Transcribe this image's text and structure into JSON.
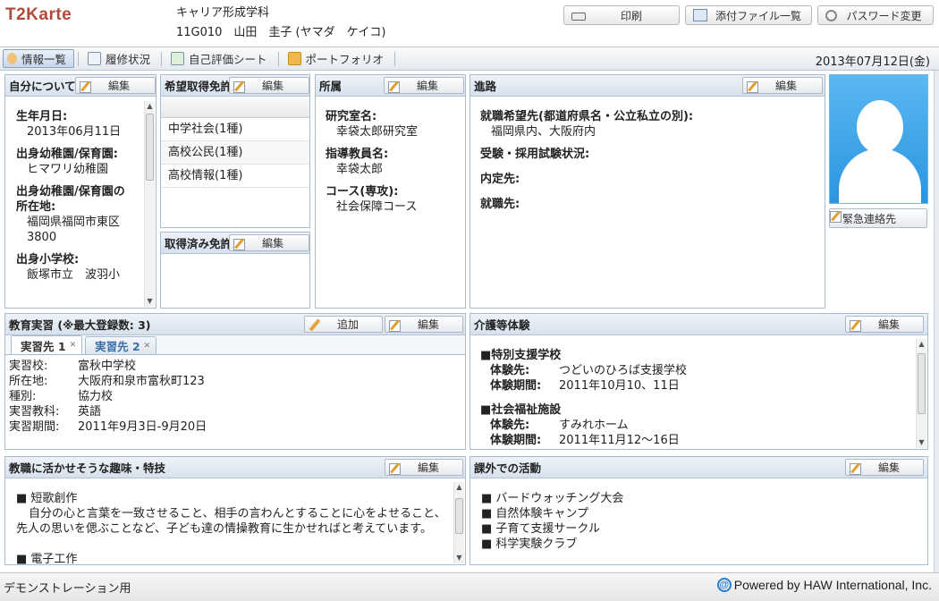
{
  "header": {
    "logo": "T2Karte",
    "department": "キャリア形成学科",
    "student_line": "11G010　山田　圭子 (ヤマダ　ケイコ)",
    "buttons": {
      "print": "印刷",
      "attachments": "添付ファイル一覧",
      "password": "パスワード変更"
    }
  },
  "nav": {
    "tabs": [
      "情報一覧",
      "履修状況",
      "自己評価シート",
      "ポートフォリオ"
    ],
    "date": "2013年07月12日(金)"
  },
  "common": {
    "edit": "編集",
    "add": "追加"
  },
  "about": {
    "title": "自分について",
    "fields": [
      {
        "label": "生年月日:",
        "value": "2013年06月11日"
      },
      {
        "label": "出身幼稚園/保育園:",
        "value": "ヒマワリ幼稚園"
      },
      {
        "label": "出身幼稚園/保育園の所在地:",
        "value": "福岡県福岡市東区3800"
      },
      {
        "label": "出身小学校:",
        "value": "飯塚市立　波羽小"
      }
    ]
  },
  "desired_license": {
    "title": "希望取得免許",
    "items": [
      "中学社会(1種)",
      "高校公民(1種)",
      "高校情報(1種)"
    ]
  },
  "acquired_license": {
    "title": "取得済み免許"
  },
  "affiliation": {
    "title": "所属",
    "fields": [
      {
        "label": "研究室名:",
        "value": "幸袋太郎研究室"
      },
      {
        "label": "指導教員名:",
        "value": "幸袋太郎"
      },
      {
        "label": "コース(専攻):",
        "value": "社会保障コース"
      }
    ]
  },
  "career": {
    "title": "進路",
    "fields": [
      {
        "label": "就職希望先(都道府県名・公立私立の別):",
        "value": "福岡県内、大阪府内"
      },
      {
        "label": "受験・採用試験状況:",
        "value": ""
      },
      {
        "label": "内定先:",
        "value": ""
      },
      {
        "label": "就職先:",
        "value": ""
      }
    ]
  },
  "emergency": {
    "label": "緊急連絡先"
  },
  "practicum": {
    "title": "教育実習 (※最大登録数: 3)",
    "tabs": [
      "実習先 1",
      "実習先 2"
    ],
    "rows": [
      {
        "k": "実習校:",
        "v": "富秋中学校"
      },
      {
        "k": "所在地:",
        "v": "大阪府和泉市富秋町123"
      },
      {
        "k": "種別:",
        "v": "協力校"
      },
      {
        "k": "実習教科:",
        "v": "英語"
      },
      {
        "k": "実習期間:",
        "v": "2011年9月3日-9月20日"
      }
    ]
  },
  "care": {
    "title": "介護等体験",
    "groups": [
      {
        "heading": "■特別支援学校",
        "place_k": "体験先:",
        "place_v": "つどいのひろば支援学校",
        "period_k": "体験期間:",
        "period_v": "2011年10月10、11日"
      },
      {
        "heading": "■社会福祉施設",
        "place_k": "体験先:",
        "place_v": "すみれホーム",
        "period_k": "体験期間:",
        "period_v": "2011年11月12〜16日"
      }
    ]
  },
  "hobbies": {
    "title": "教職に活かせそうな趣味・特技",
    "item1": "■ 短歌創作",
    "item1_text1": "自分の心と言葉を一致させること、相手の言わんとすることに心をよせること、",
    "item1_text2": "先人の思いを偲ぶことなど、子ども達の情操教育に生かせればと考えています。",
    "item2": "■ 電子工作"
  },
  "activities": {
    "title": "課外での活動",
    "items": [
      "■ バードウォッチング大会",
      "■ 自然体験キャンプ",
      "■ 子育て支援サークル",
      "■ 科学実験クラブ"
    ]
  },
  "footer": {
    "left": "デモンストレーション用",
    "powered": "Powered by HAW International, Inc."
  }
}
